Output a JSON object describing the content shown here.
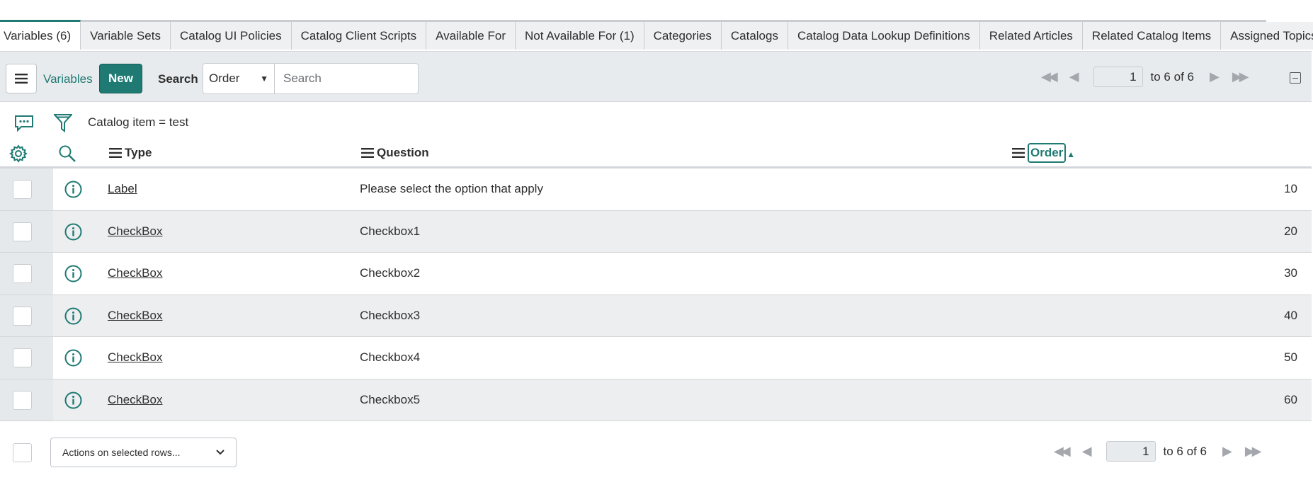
{
  "tabs": [
    {
      "label": "Variables (6)",
      "active": true
    },
    {
      "label": "Variable Sets"
    },
    {
      "label": "Catalog UI Policies"
    },
    {
      "label": "Catalog Client Scripts"
    },
    {
      "label": "Available For"
    },
    {
      "label": "Not Available For (1)"
    },
    {
      "label": "Categories"
    },
    {
      "label": "Catalogs"
    },
    {
      "label": "Catalog Data Lookup Definitions"
    },
    {
      "label": "Related Articles"
    },
    {
      "label": "Related Catalog Items"
    },
    {
      "label": "Assigned Topics"
    }
  ],
  "toolbar": {
    "list_title": "Variables",
    "new_label": "New",
    "search_label": "Search",
    "search_field": "Order",
    "search_placeholder": "Search"
  },
  "pager_top": {
    "page": "1",
    "range_text": "to 6 of 6"
  },
  "filter": {
    "text": "Catalog item = test"
  },
  "columns": {
    "type": "Type",
    "question": "Question",
    "order": "Order"
  },
  "rows": [
    {
      "type": "Label",
      "question": "Please select the option that apply",
      "order": "10"
    },
    {
      "type": "CheckBox",
      "question": "Checkbox1",
      "order": "20"
    },
    {
      "type": "CheckBox",
      "question": "Checkbox2",
      "order": "30"
    },
    {
      "type": "CheckBox",
      "question": "Checkbox3",
      "order": "40"
    },
    {
      "type": "CheckBox",
      "question": "Checkbox4",
      "order": "50"
    },
    {
      "type": "CheckBox",
      "question": "Checkbox5",
      "order": "60"
    }
  ],
  "footer": {
    "actions_label": "Actions on selected rows..."
  },
  "pager_bottom": {
    "page": "1",
    "range_text": "to 6 of 6"
  },
  "colors": {
    "accent": "#1f7a73",
    "row_alt": "#eceeef"
  }
}
